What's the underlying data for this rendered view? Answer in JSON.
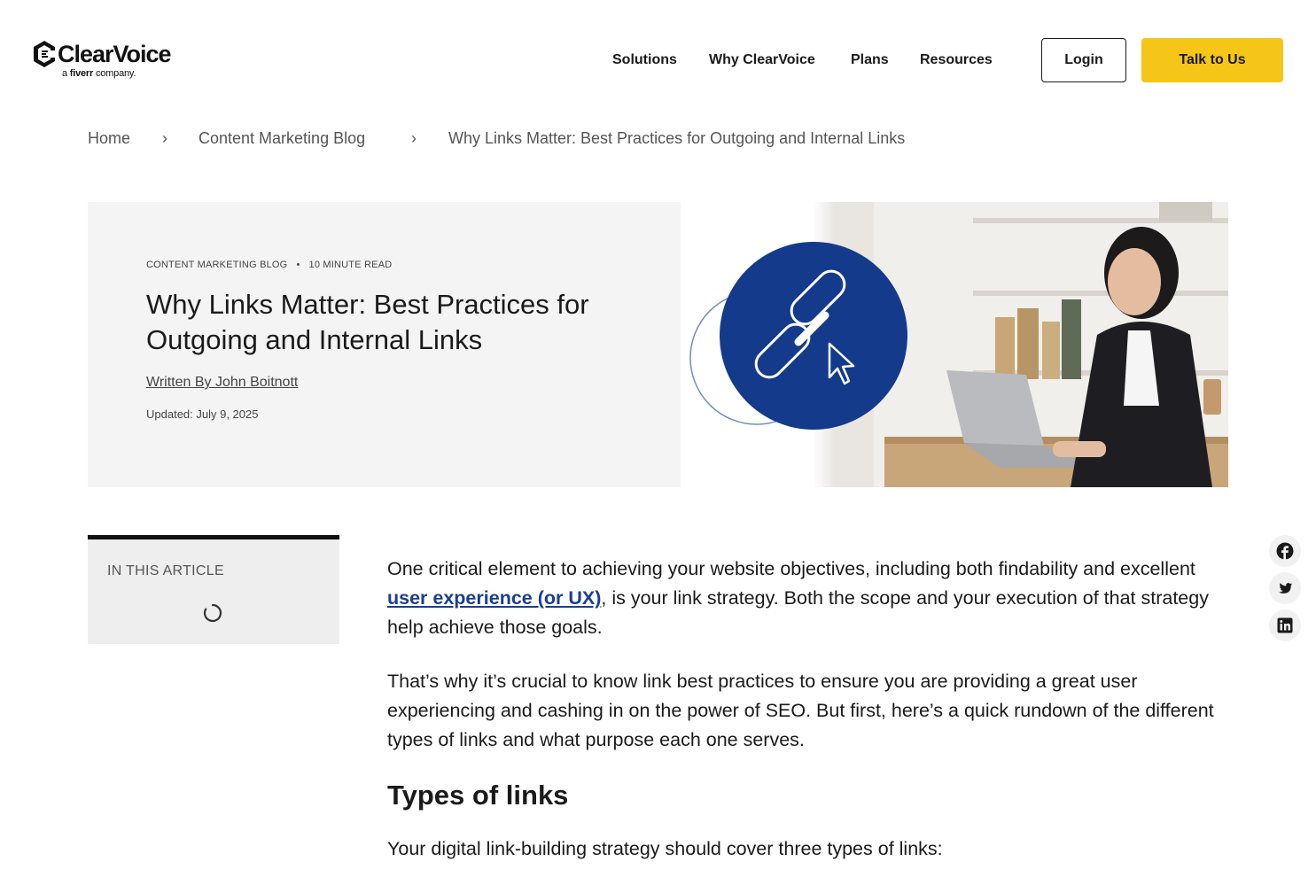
{
  "header": {
    "logo_text": "ClearVoice",
    "logo_sub_prefix": "a",
    "logo_sub_brand": "fiverr",
    "logo_sub_suffix": "company.",
    "nav": [
      "Solutions",
      "Why ClearVoice",
      "Plans",
      "Resources"
    ],
    "login_label": "Login",
    "cta_label": "Talk to Us"
  },
  "breadcrumb": {
    "items": [
      "Home",
      "Content Marketing Blog"
    ],
    "separator": "›",
    "current": "Why Links Matter: Best Practices for Outgoing and Internal Links"
  },
  "hero": {
    "category": "CONTENT MARKETING BLOG",
    "dot": "•",
    "read_time": "10 MINUTE READ",
    "title": "Why Links Matter: Best Practices for Outgoing and Internal Links",
    "author": "Written By John Boitnott",
    "updated": "Updated: July 9, 2025",
    "image_icons": [
      "link-chain-icon",
      "cursor-arrow-icon"
    ]
  },
  "toc": {
    "title": "IN THIS ARTICLE",
    "loading_icon": "spinner-icon"
  },
  "article": {
    "p1_before": "One critical element to achieving your website objectives, including both findability and excellent ",
    "p1_link": "user experience (or UX)",
    "p1_after": ", is your link strategy. Both the scope and your execution of that strategy help achieve those goals.",
    "p2": "That’s why it’s crucial to know link best practices to ensure you are providing a great user experiencing and cashing in on the power of SEO. But first, here’s a quick rundown of the different types of links and what purpose each one serves.",
    "h2": "Types of links",
    "p3": "Your digital link-building strategy should cover three types of links:"
  },
  "share": {
    "icons": [
      "facebook-icon",
      "twitter-icon",
      "linkedin-icon"
    ]
  },
  "colors": {
    "cta": "#f5c518",
    "link": "#1a3f8f",
    "hero_circle": "#143a8c",
    "hero_bg": "#f4f4f4"
  }
}
